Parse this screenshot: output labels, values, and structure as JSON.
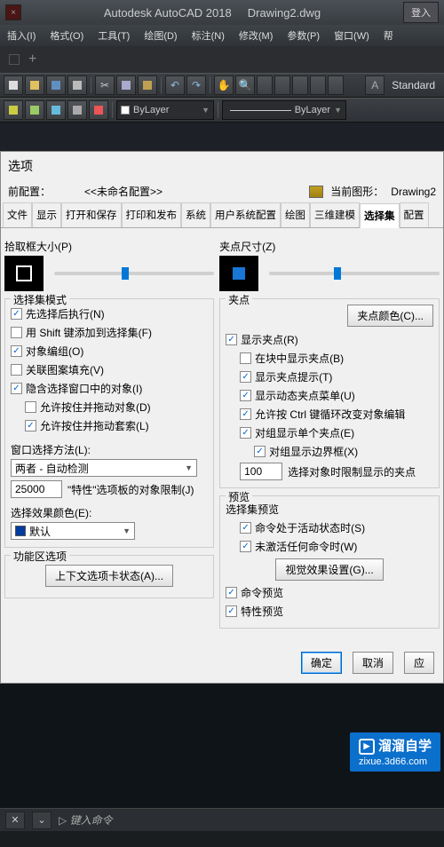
{
  "titlebar": {
    "app": "Autodesk AutoCAD 2018",
    "file": "Drawing2.dwg",
    "login": "登入"
  },
  "menubar": [
    "插入(I)",
    "格式(O)",
    "工具(T)",
    "绘图(D)",
    "标注(N)",
    "修改(M)",
    "参数(P)",
    "窗口(W)",
    "帮"
  ],
  "toolbar": {
    "standard": "Standard",
    "bylayer1": "ByLayer",
    "bylayer2": "ByLayer"
  },
  "dialog": {
    "title": "选项",
    "profile_label": "前配置：",
    "profile_value": "<<未命名配置>>",
    "drawing_label": "当前图形：",
    "drawing_value": "Drawing2",
    "tabs": [
      "文件",
      "显示",
      "打开和保存",
      "打印和发布",
      "系统",
      "用户系统配置",
      "绘图",
      "三维建模",
      "选择集",
      "配置"
    ],
    "activeTab": "选择集",
    "left": {
      "pickbox_label": "拾取框大小(P)",
      "select_mode_legend": "选择集模式",
      "opts": {
        "a": "先选择后执行(N)",
        "b": "用 Shift 键添加到选择集(F)",
        "c": "对象编组(O)",
        "d": "关联图案填充(V)",
        "e": "隐含选择窗口中的对象(I)",
        "f": "允许按住并拖动对象(D)",
        "g": "允许按住并拖动套索(L)"
      },
      "window_method_label": "窗口选择方法(L):",
      "window_method_value": "两者 - 自动检测",
      "limit_value": "25000",
      "limit_label": "\"特性\"选项板的对象限制(J)",
      "effect_color_label": "选择效果颜色(E):",
      "effect_color_value": "默认",
      "fn_legend": "功能区选项",
      "fn_btn": "上下文选项卡状态(A)..."
    },
    "right": {
      "grip_size_label": "夹点尺寸(Z)",
      "grip_legend": "夹点",
      "grip_color_btn": "夹点颜色(C)...",
      "opts": {
        "a": "显示夹点(R)",
        "b": "在块中显示夹点(B)",
        "c": "显示夹点提示(T)",
        "d": "显示动态夹点菜单(U)",
        "e": "允许按 Ctrl 键循环改变对象编辑",
        "f": "对组显示单个夹点(E)",
        "g": "对组显示边界框(X)"
      },
      "grip_limit_value": "100",
      "grip_limit_label": "选择对象时限制显示的夹点",
      "preview_legend": "预览",
      "preview_sub": "选择集预览",
      "p_a": "命令处于活动状态时(S)",
      "p_b": "未激活任何命令时(W)",
      "vis_btn": "视觉效果设置(G)...",
      "p_c": "命令预览",
      "p_d": "特性预览"
    },
    "buttons": {
      "ok": "确定",
      "cancel": "取消",
      "apply": "应"
    }
  },
  "cmdline": {
    "placeholder": "键入命令"
  },
  "watermark": {
    "brand": "溜溜自学",
    "url": "zixue.3d66.com"
  }
}
